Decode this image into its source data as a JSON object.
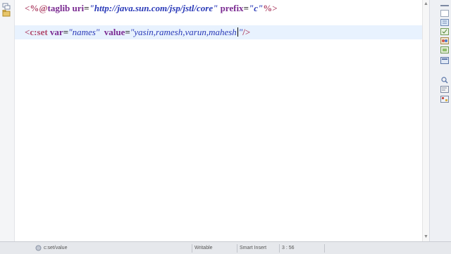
{
  "editor": {
    "line1": {
      "open": "<%@",
      "directive": "taglib",
      "attr1": "uri",
      "eq1": "=",
      "val1": "\"http://java.sun.com/jsp/jstl/core\"",
      "attr2": "prefix",
      "eq2": "=",
      "val2": "\"c\"",
      "close": "%>"
    },
    "line2": {
      "open": "<c:set",
      "attr1": "var",
      "eq1": "=",
      "val1": "\"names\"",
      "attr2": "value",
      "eq2": "=",
      "val2_before_caret": "\"yasin,ramesh,varun,mahesh",
      "val2_after_caret": "\"",
      "close": "/>"
    }
  },
  "status_bar": {
    "breadcrumb": "c:set/value",
    "mode": "Writable",
    "insert_mode": "Smart Insert",
    "cursor_position": "3 : 56"
  },
  "colors": {
    "current_line_highlight": "#e8f2fe",
    "tag": "#b24b6d",
    "attribute": "#7a2a91",
    "string_value": "#2a3ab8"
  }
}
